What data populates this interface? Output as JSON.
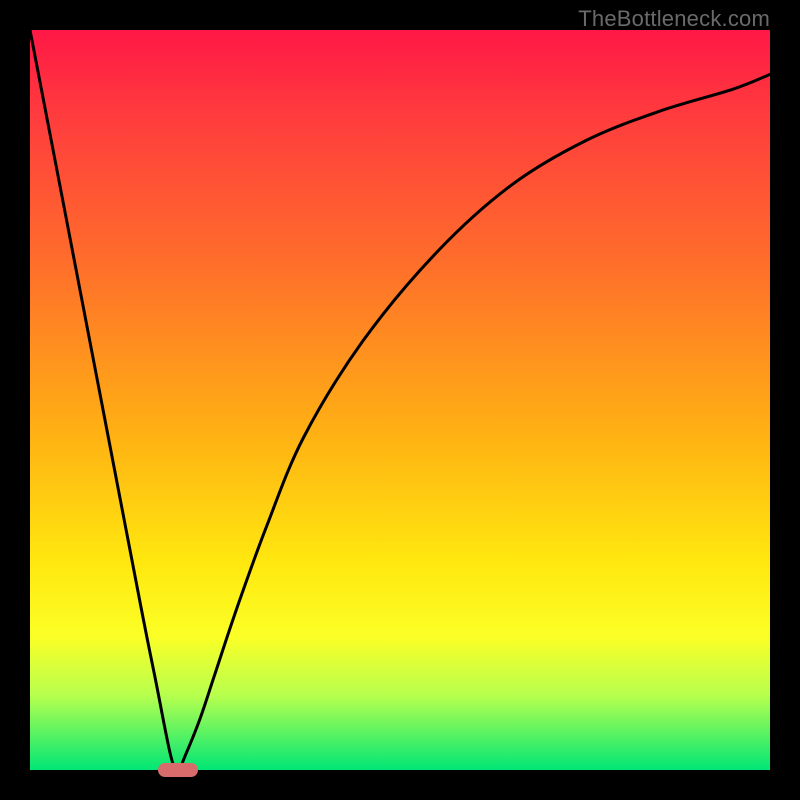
{
  "watermark": "TheBottleneck.com",
  "chart_data": {
    "type": "line",
    "title": "",
    "xlabel": "",
    "ylabel": "",
    "xlim": [
      0,
      100
    ],
    "ylim": [
      0,
      100
    ],
    "background_gradient": {
      "direction": "vertical",
      "stops": [
        {
          "pos": 0,
          "color": "#ff1846"
        },
        {
          "pos": 12,
          "color": "#ff3d3d"
        },
        {
          "pos": 30,
          "color": "#ff6a2c"
        },
        {
          "pos": 55,
          "color": "#ffb213"
        },
        {
          "pos": 72,
          "color": "#ffe80f"
        },
        {
          "pos": 82,
          "color": "#fbff26"
        },
        {
          "pos": 90,
          "color": "#b6ff4e"
        },
        {
          "pos": 100,
          "color": "#00e676"
        }
      ]
    },
    "series": [
      {
        "name": "bottleneck-curve",
        "x": [
          0,
          5,
          10,
          15,
          17,
          19,
          20,
          21,
          23,
          25,
          28,
          32,
          37,
          45,
          55,
          65,
          75,
          85,
          95,
          100
        ],
        "values": [
          100,
          74,
          48,
          22,
          12,
          2,
          0,
          2,
          7,
          13,
          22,
          33,
          45,
          58,
          70,
          79,
          85,
          89,
          92,
          94
        ]
      }
    ],
    "marker": {
      "x": 20,
      "y": 0,
      "width_pct": 5.5,
      "color": "#d86b6b"
    },
    "frame_color": "#000000"
  }
}
